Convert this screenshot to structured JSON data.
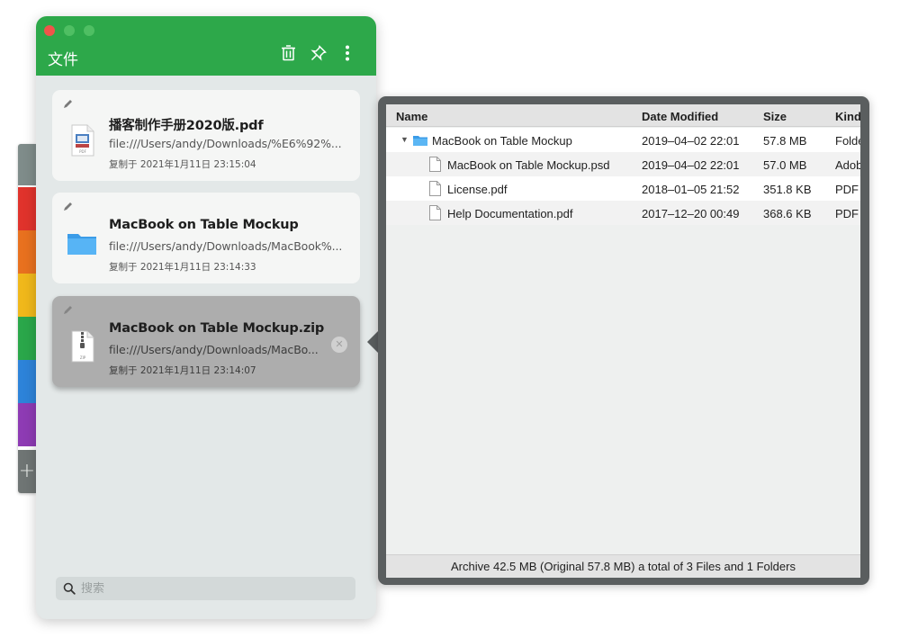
{
  "window": {
    "title": "文件",
    "toolbar_icons": [
      "trash-icon",
      "pin-icon",
      "more-vertical-icon"
    ]
  },
  "tabs": {
    "colors": [
      "#7f8c8a",
      "#e0332c",
      "#e8711f",
      "#f0b81b",
      "#2aa74a",
      "#2d83d9",
      "#8e3bb4"
    ],
    "add_label": "+"
  },
  "cards": [
    {
      "name": "播客制作手册2020版.pdf",
      "path": "file:///Users/andy/Downloads/%E6%92%...",
      "copied": "复制于 2021年1月11日 23:15:04",
      "icon": "pdf-file-icon",
      "selected": false
    },
    {
      "name": "MacBook on Table Mockup",
      "path": "file:///Users/andy/Downloads/MacBook%...",
      "copied": "复制于 2021年1月11日 23:14:33",
      "icon": "folder-icon",
      "selected": false
    },
    {
      "name": "MacBook on Table Mockup.zip",
      "path": "file:///Users/andy/Downloads/MacBo...",
      "copied": "复制于 2021年1月11日 23:14:07",
      "icon": "zip-file-icon",
      "selected": true
    }
  ],
  "search": {
    "placeholder": "搜索",
    "value": ""
  },
  "browser": {
    "columns": {
      "name": "Name",
      "date": "Date Modified",
      "size": "Size",
      "kind": "Kind"
    },
    "rows": [
      {
        "name": "MacBook on Table Mockup",
        "date": "2019–04–02 22:01",
        "size": "57.8 MB",
        "kind": "Folder",
        "type": "folder",
        "expanded": true
      },
      {
        "name": "MacBook on Table Mockup.psd",
        "date": "2019–04–02 22:01",
        "size": "57.0 MB",
        "kind": "Adobe",
        "type": "file"
      },
      {
        "name": "License.pdf",
        "date": "2018–01–05 21:52",
        "size": "351.8 KB",
        "kind": "PDF",
        "type": "file"
      },
      {
        "name": "Help Documentation.pdf",
        "date": "2017–12–20 00:49",
        "size": "368.6 KB",
        "kind": "PDF",
        "type": "file"
      }
    ],
    "footer": "Archive 42.5 MB (Original 57.8 MB) a total of 3 Files and 1 Folders"
  },
  "colors": {
    "titlebar": "#2da84a",
    "window_bg": "#e3e8e8",
    "popover_frame": "#5a5e5f"
  }
}
